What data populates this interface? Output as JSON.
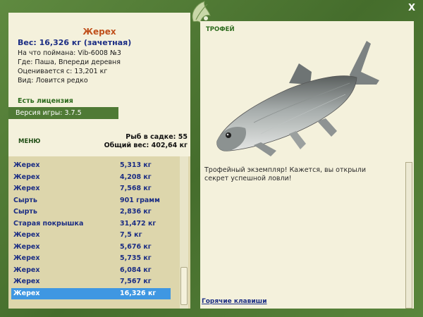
{
  "window": {
    "close_label": "X"
  },
  "fish": {
    "name": "Жерех",
    "weight": "Вес: 16,326 кг (зачетная)",
    "details": [
      "На что поймана: Vib-6008 №3",
      "Где: Паша, Впереди деревня",
      "Оценивается с: 13,201 кг",
      "Вид: Ловится редко"
    ]
  },
  "license": "Есть лицензия",
  "version": "Версия игры: 3.7.5",
  "menu_label": "МЕНЮ",
  "stats": {
    "fish_in_keepnet": "Рыб в садке: 55",
    "total_weight": "Общий вес: 402,64 кг"
  },
  "catch_list": [
    {
      "name": "Жерех",
      "weight": "5,313 кг",
      "selected": false
    },
    {
      "name": "Жерех",
      "weight": "4,208 кг",
      "selected": false
    },
    {
      "name": "Жерех",
      "weight": "7,568 кг",
      "selected": false
    },
    {
      "name": "Сырть",
      "weight": "901 грамм",
      "selected": false
    },
    {
      "name": "Сырть",
      "weight": "2,836 кг",
      "selected": false
    },
    {
      "name": "Старая покрышка",
      "weight": "31,472 кг",
      "selected": false
    },
    {
      "name": "Жерех",
      "weight": "7,5 кг",
      "selected": false
    },
    {
      "name": "Жерех",
      "weight": "5,676 кг",
      "selected": false
    },
    {
      "name": "Жерех",
      "weight": "5,735 кг",
      "selected": false
    },
    {
      "name": "Жерех",
      "weight": "6,084 кг",
      "selected": false
    },
    {
      "name": "Жерех",
      "weight": "7,567 кг",
      "selected": false
    },
    {
      "name": "Жерех",
      "weight": "16,326 кг",
      "selected": true
    }
  ],
  "trophy": {
    "title": "ТРОФЕЙ",
    "text": "Трофейный экземпляр! Кажется, вы открыли секрет успешной ловли!"
  },
  "hotkeys_label": "Горячие клавиши",
  "colors": {
    "frame_green": "#4f7a35",
    "panel_bg": "#f4f1dc",
    "list_bg": "#ddd6ac",
    "selected_row": "#3f97e2",
    "fish_name": "#c0501c",
    "navy_text": "#1b2d84"
  }
}
